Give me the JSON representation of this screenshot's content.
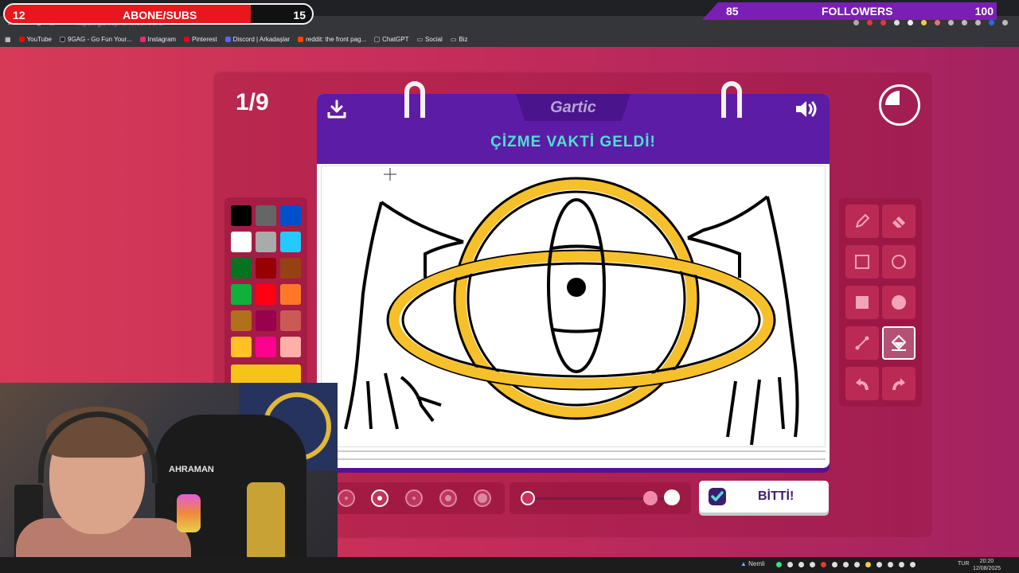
{
  "browser": {
    "url": "https://garticphone.com/tr/draw",
    "bookmarks": [
      {
        "label": "YouTube",
        "color": "#ff0000"
      },
      {
        "label": "9GAG - Go Fun Your...",
        "color": "#222222"
      },
      {
        "label": "Instagram",
        "color": "#e1306c"
      },
      {
        "label": "Pinterest",
        "color": "#e60023"
      },
      {
        "label": "Discord | Arkadaşlar",
        "color": "#5865f2"
      },
      {
        "label": "reddit: the front pag...",
        "color": "#ff4500"
      },
      {
        "label": "ChatGPT",
        "color": "#333333"
      },
      {
        "label": "Social",
        "color": "#c9c9c9"
      },
      {
        "label": "Biz",
        "color": "#c9c9c9"
      }
    ]
  },
  "overlay": {
    "subs": {
      "current": "12",
      "label": "ABONE/SUBS",
      "goal": "15",
      "progress": 0.8
    },
    "followers": {
      "current": "85",
      "label": "FOLLOWERS",
      "goal": "100"
    }
  },
  "game": {
    "round": "1/9",
    "logo": "Gartic",
    "headline": "ÇİZME VAKTİ GELDİ!",
    "timer_elapsed_percent": 75,
    "done_label": "BİTTİ!",
    "icons": {
      "download": "download-icon",
      "volume": "volume-icon",
      "timer": "timer-icon"
    },
    "palette": [
      "#000000",
      "#666666",
      "#0050cd",
      "#ffffff",
      "#aaaaaa",
      "#26c9ff",
      "#017420",
      "#990000",
      "#964112",
      "#11b03c",
      "#ff0013",
      "#ff7829",
      "#b0701c",
      "#99004e",
      "#cb5a57",
      "#ffc126",
      "#ff008f",
      "#feafa8"
    ],
    "selected_color": "#f5c419",
    "tools": [
      {
        "name": "pencil-icon",
        "active": false
      },
      {
        "name": "eraser-icon",
        "active": false
      },
      {
        "name": "rectangle-icon",
        "active": false
      },
      {
        "name": "ellipse-icon",
        "active": false
      },
      {
        "name": "filled-rectangle-icon",
        "active": false
      },
      {
        "name": "filled-ellipse-icon",
        "active": false
      },
      {
        "name": "line-icon",
        "active": false
      },
      {
        "name": "bucket-icon",
        "active": true
      },
      {
        "name": "undo-icon",
        "active": false
      },
      {
        "name": "redo-icon",
        "active": false
      }
    ],
    "brush_sizes_selected": 1,
    "opacity_level": 0.87
  },
  "webcam": {
    "chair_text": "AHRAMAN"
  },
  "taskbar": {
    "weather": "Nemli",
    "lang": "TUR",
    "time": "20:20",
    "date": "12/08/2025"
  }
}
